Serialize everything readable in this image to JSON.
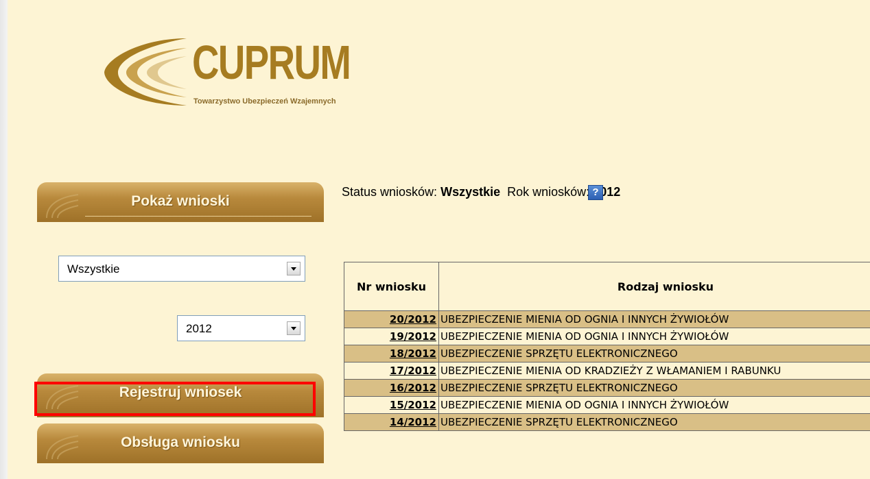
{
  "logo": {
    "brand": "CUPRUM",
    "subtitle": "Towarzystwo Ubezpieczeń Wzajemnych"
  },
  "sidebar": {
    "show_button": "Pokaż wnioski",
    "status_select": "Wszystkie",
    "year_select": "2012",
    "register_button": "Rejestruj wniosek",
    "service_button": "Obsługa wniosku"
  },
  "status_line": {
    "status_label": "Status wniosków:",
    "status_value": "Wszystkie",
    "year_label": "Rok wniosków:",
    "year_value": "2012",
    "help": "?"
  },
  "table": {
    "headers": [
      "Nr wniosku",
      "Rodzaj wniosku"
    ],
    "rows": [
      {
        "nr": "20/2012",
        "kind": "UBEZPIECZENIE MIENIA OD OGNIA I INNYCH ŻYWIOŁÓW"
      },
      {
        "nr": "19/2012",
        "kind": "UBEZPIECZENIE MIENIA OD OGNIA I INNYCH ŻYWIOŁÓW"
      },
      {
        "nr": "18/2012",
        "kind": "UBEZPIECZENIE SPRZĘTU ELEKTRONICZNEGO"
      },
      {
        "nr": "17/2012",
        "kind": "UBEZPIECZENIE MIENIA OD KRADZIEŻY Z WŁAMANIEM I RABUNKU"
      },
      {
        "nr": "16/2012",
        "kind": "UBEZPIECZENIE SPRZĘTU ELEKTRONICZNEGO"
      },
      {
        "nr": "15/2012",
        "kind": "UBEZPIECZENIE MIENIA OD OGNIA I INNYCH ŻYWIOŁÓW"
      },
      {
        "nr": "14/2012",
        "kind": "UBEZPIECZENIE SPRZĘTU ELEKTRONICZNEGO"
      }
    ]
  },
  "colors": {
    "page_bg": "#fdf4d4",
    "gold": "#a67c21",
    "row_alt": "#d9bf86",
    "highlight": "#ff0000"
  }
}
